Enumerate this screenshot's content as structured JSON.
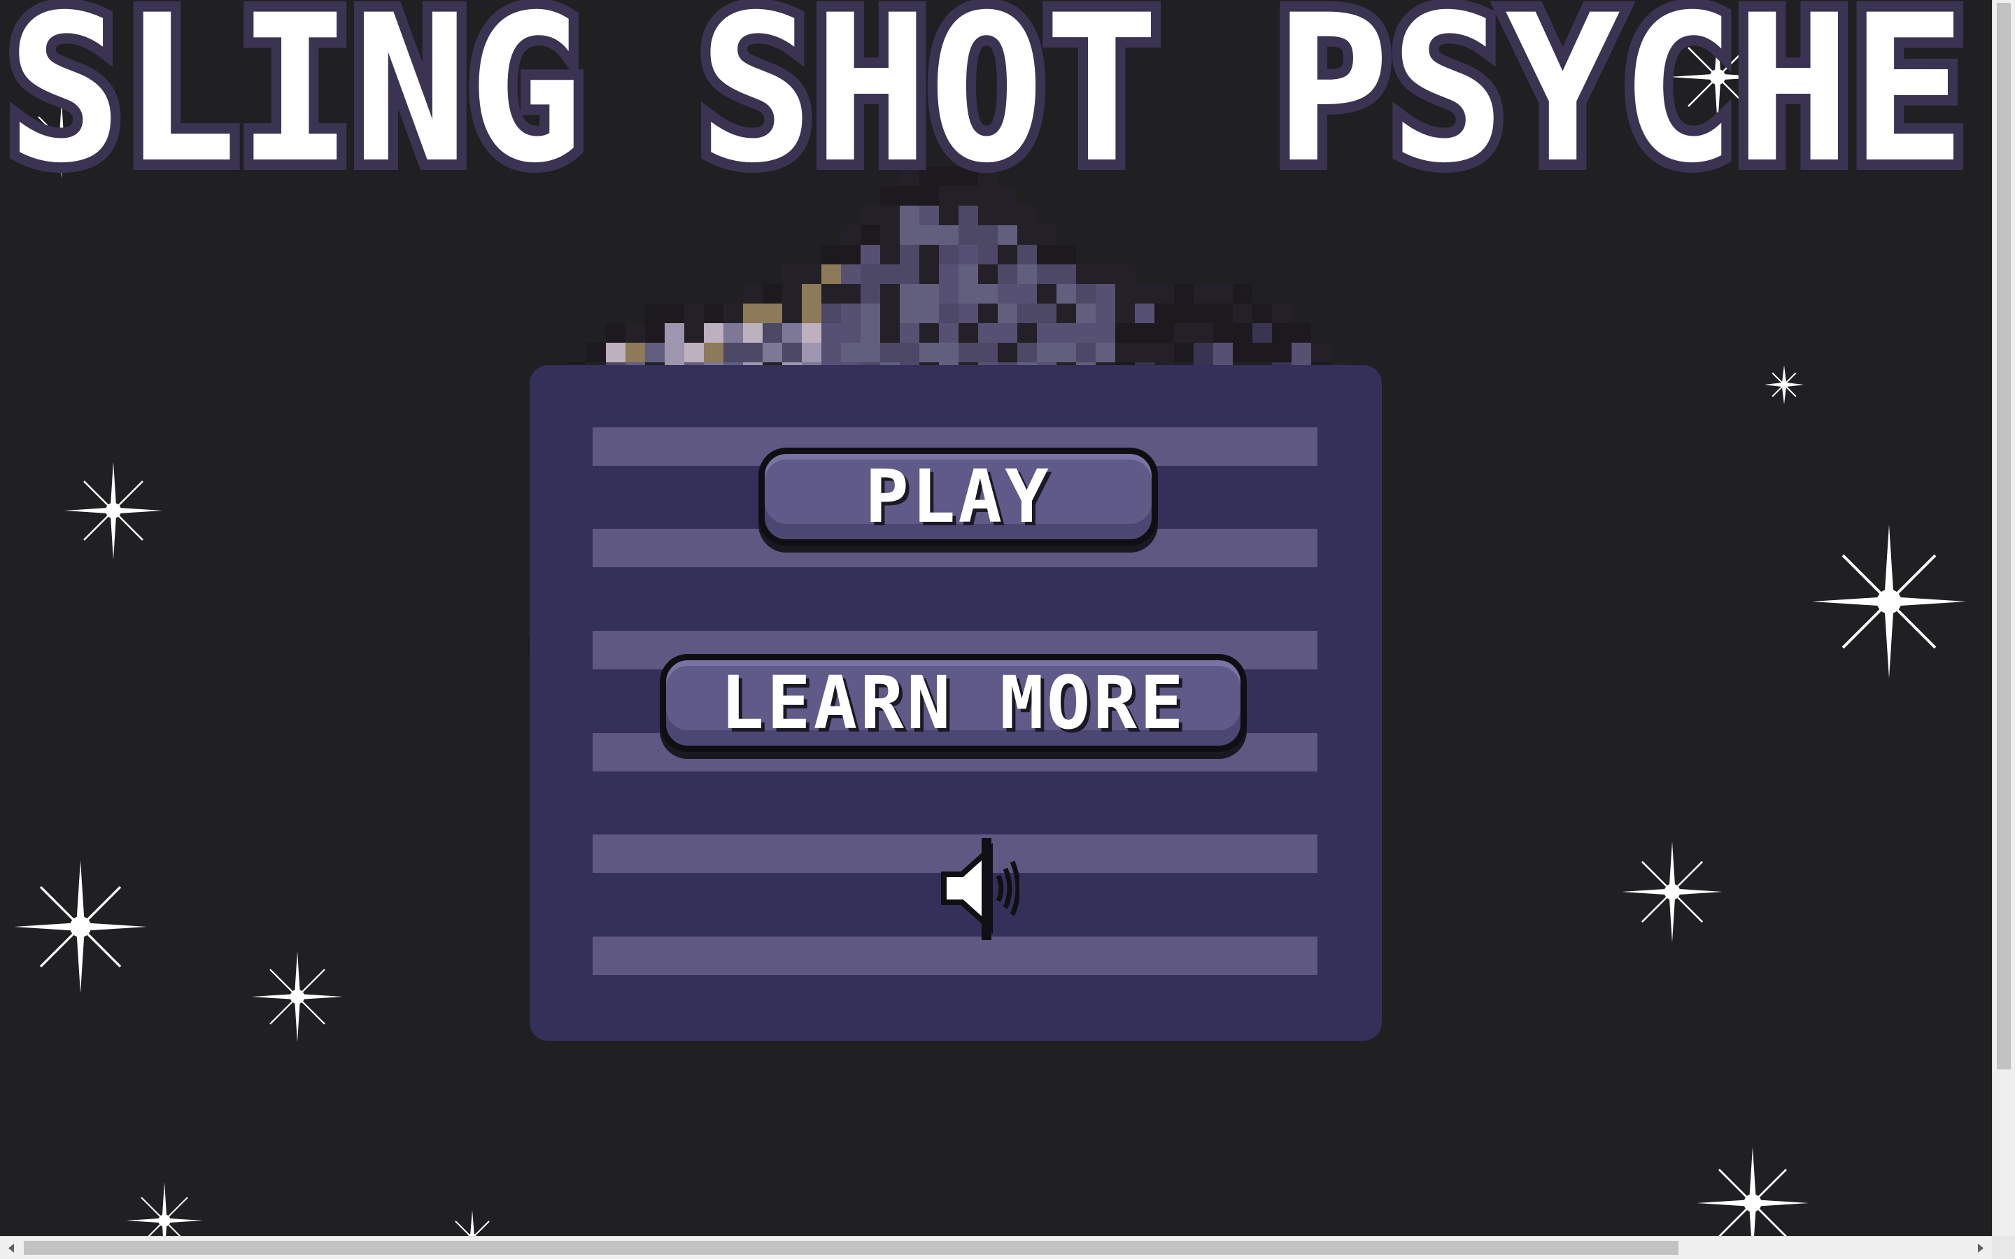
{
  "game": {
    "title": "SLING SHOT PSYCHE"
  },
  "menu": {
    "play_label": "PLAY",
    "learn_more_label": "LEARN MORE",
    "sound_icon": "speaker-sound-on-icon"
  },
  "colors": {
    "background": "#201f21",
    "panel": "#34305a",
    "stripe": "#5e5883",
    "button": "#5f5a87",
    "button_border": "#0f0e12",
    "title_text": "#ffffff",
    "title_outline": "#3a3452",
    "star": "#ffffff",
    "asteroid_palette": [
      "#7c7896",
      "#625e7e",
      "#9e96ae",
      "#4c4866",
      "#bdb0bf",
      "#8c7a58",
      "#39344f",
      "#242027",
      "#1c1a1e",
      "#565072"
    ]
  },
  "icons": {
    "stars": "sparkle-star-icon",
    "scroll_left": "chevron-left-icon",
    "scroll_right": "chevron-right-icon"
  }
}
